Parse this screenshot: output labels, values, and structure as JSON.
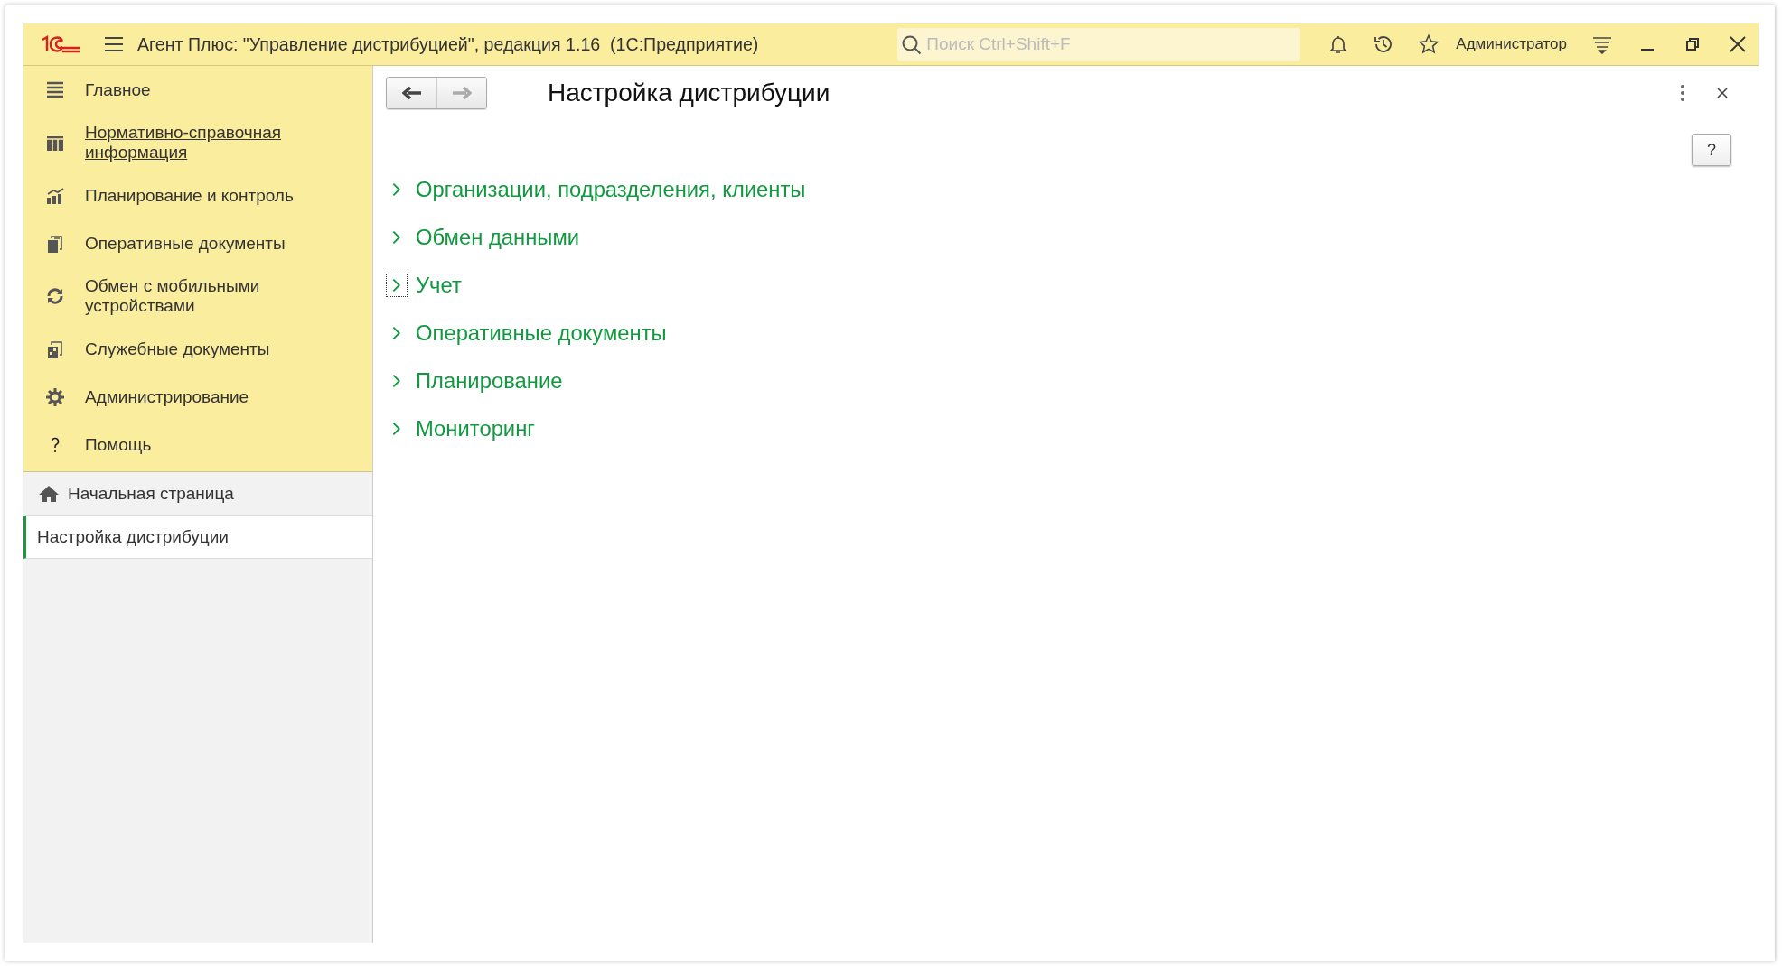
{
  "window": {
    "title": "Агент Плюс: \"Управление дистрибуцией\", редакция 1.16  (1С:Предприятие)",
    "search": {
      "placeholder": "Поиск Ctrl+Shift+F"
    },
    "user": "Администратор"
  },
  "sidebar": {
    "items": [
      {
        "label": "Главное",
        "hovered": false
      },
      {
        "label": "Нормативно-справочная информация",
        "hovered": true
      },
      {
        "label": "Планирование и контроль",
        "hovered": false
      },
      {
        "label": "Оперативные документы",
        "hovered": false
      },
      {
        "label": "Обмен с мобильными устройствами",
        "hovered": false
      },
      {
        "label": "Служебные документы",
        "hovered": false
      },
      {
        "label": "Администрирование",
        "hovered": false
      },
      {
        "label": "Помощь",
        "hovered": false
      }
    ],
    "open_windows": [
      {
        "label": "Начальная страница",
        "kind": "home",
        "selected": false
      },
      {
        "label": "Настройка дистрибуции",
        "kind": "form",
        "selected": true
      }
    ]
  },
  "form": {
    "title": "Настройка дистрибуции",
    "nav": {
      "back_disabled": false,
      "forward_disabled": true
    },
    "help_button": "?",
    "sections": [
      {
        "label": "Организации, подразделения, клиенты",
        "focused": false
      },
      {
        "label": "Обмен данными",
        "focused": false
      },
      {
        "label": "Учет",
        "focused": true
      },
      {
        "label": "Оперативные документы",
        "focused": false
      },
      {
        "label": "Планирование",
        "focused": false
      },
      {
        "label": "Мониторинг",
        "focused": false
      }
    ]
  }
}
